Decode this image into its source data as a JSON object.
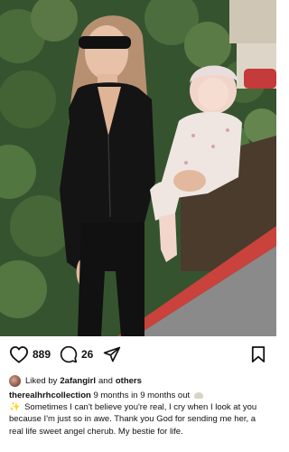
{
  "post": {
    "likes_count": "889",
    "comments_count": "26",
    "liked_by_prefix": "Liked by",
    "liked_by_user": "2afangirl",
    "liked_by_and": "and",
    "liked_by_others": "others",
    "username": "therealhrhcollection",
    "caption_text": "9 months in 9 months out",
    "caption_emoji_1": "shell-emoji",
    "caption_emoji_2": "sparkles-emoji",
    "caption_sparkle_glyph": "✨",
    "caption_body": "Sometimes I can't believe you're real, I cry when I look at you because I'm just so in awe. Thank you God for sending me her, a real life sweet angel cherub. My bestie for life."
  },
  "icons": {
    "like": "heart-icon",
    "comment": "comment-icon",
    "share": "paper-plane-icon",
    "save": "bookmark-icon"
  },
  "colors": {
    "text": "#111111",
    "curb": "#c9423c",
    "foliage": "#3a5632",
    "background": "#ffffff"
  }
}
